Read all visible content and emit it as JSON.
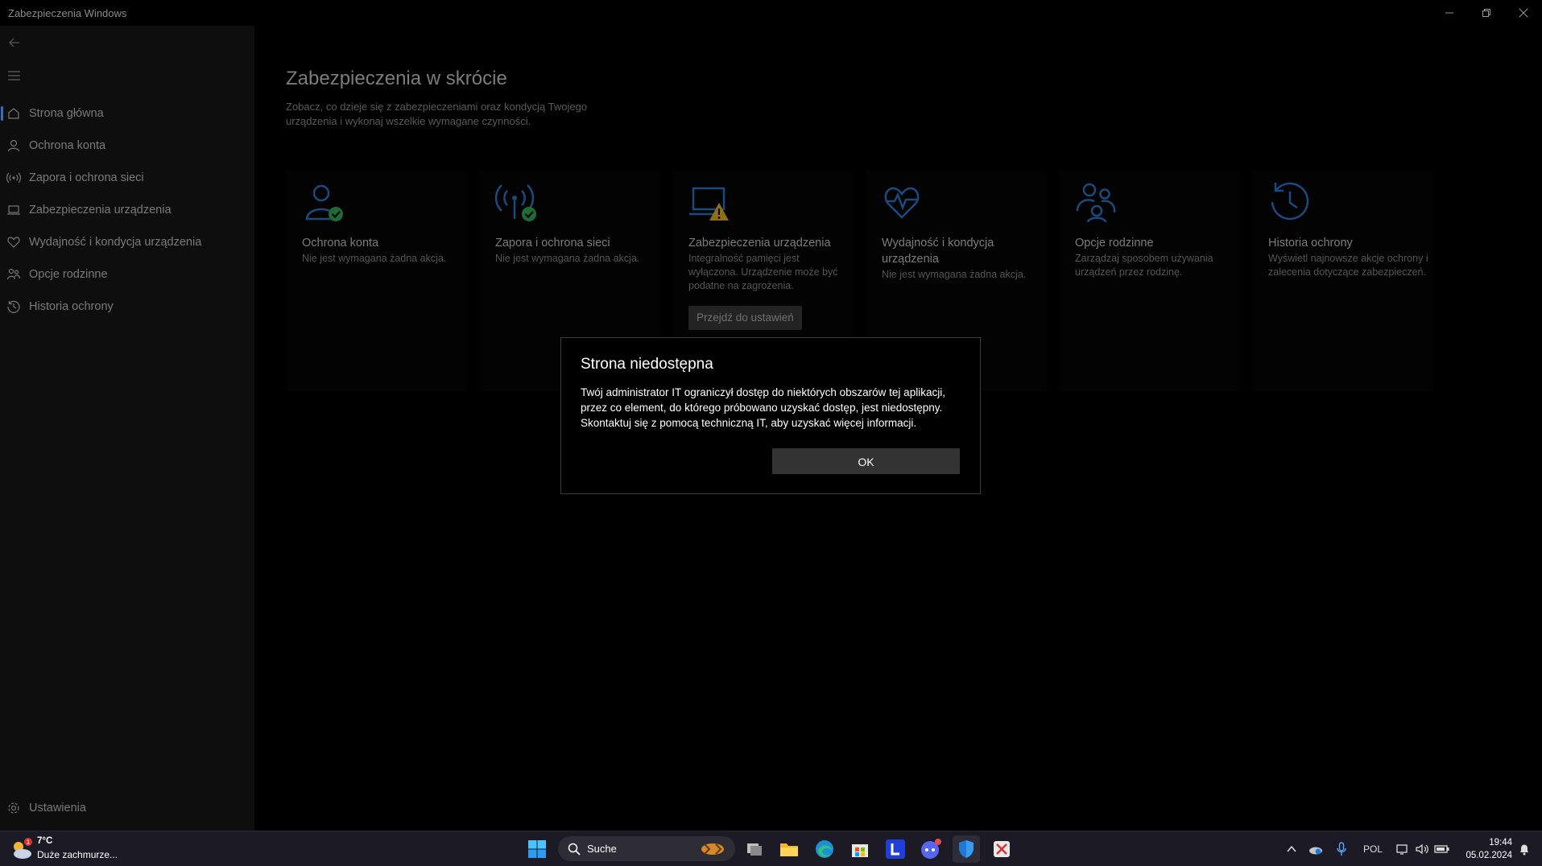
{
  "window": {
    "title": "Zabezpieczenia Windows"
  },
  "sidebar": {
    "items": [
      {
        "label": "Strona główna",
        "icon": "home-icon"
      },
      {
        "label": "Ochrona konta",
        "icon": "person-icon"
      },
      {
        "label": "Zapora i ochrona sieci",
        "icon": "antenna-icon"
      },
      {
        "label": "Zabezpieczenia urządzenia",
        "icon": "laptop-icon"
      },
      {
        "label": "Wydajność i kondycja urządzenia",
        "icon": "heart-icon"
      },
      {
        "label": "Opcje rodzinne",
        "icon": "family-icon"
      },
      {
        "label": "Historia ochrony",
        "icon": "history-icon"
      }
    ],
    "settings_label": "Ustawienia"
  },
  "main": {
    "title": "Zabezpieczenia w skrócie",
    "description": "Zobacz, co dzieje się z zabezpieczeniami oraz kondycją Twojego urządzenia i wykonaj wszelkie wymagane czynności.",
    "cards": [
      {
        "title": "Ochrona konta",
        "desc": "Nie jest wymagana żadna akcja.",
        "icon": "account-protection-icon"
      },
      {
        "title": "Zapora i ochrona sieci",
        "desc": "Nie jest wymagana żadna akcja.",
        "icon": "firewall-icon"
      },
      {
        "title": "Zabezpieczenia urządzenia",
        "desc": "Integralność pamięci jest wyłączona. Urządzenie może być podatne na zagrożenia.",
        "icon": "device-security-warning-icon",
        "button": "Przejdź do ustawień"
      },
      {
        "title": "Wydajność i kondycja urządzenia",
        "desc": "Nie jest wymagana żadna akcja.",
        "icon": "health-icon"
      },
      {
        "title": "Opcje rodzinne",
        "desc": "Zarządzaj sposobem używania urządzeń przez rodzinę.",
        "icon": "family-options-icon"
      },
      {
        "title": "Historia ochrony",
        "desc": "Wyświetl najnowsze akcje ochrony i zalecenia dotyczące zabezpieczeń.",
        "icon": "protection-history-icon"
      }
    ]
  },
  "dialog": {
    "title": "Strona niedostępna",
    "message": "Twój administrator IT ograniczył dostęp do niektórych obszarów tej aplikacji, przez co element, do którego próbowano uzyskać dostęp, jest niedostępny. Skontaktuj się z pomocą techniczną IT, aby uzyskać więcej informacji.",
    "ok_label": "OK"
  },
  "taskbar": {
    "weather": {
      "temp": "7°C",
      "desc": "Duże zachmurze...",
      "badge": "1"
    },
    "search_label": "Suche",
    "language": "POL",
    "time": "19:44",
    "date": "05.02.2024"
  },
  "colors": {
    "accent": "#3a6fb5",
    "success": "#2f9e44",
    "warning": "#c9a227"
  }
}
